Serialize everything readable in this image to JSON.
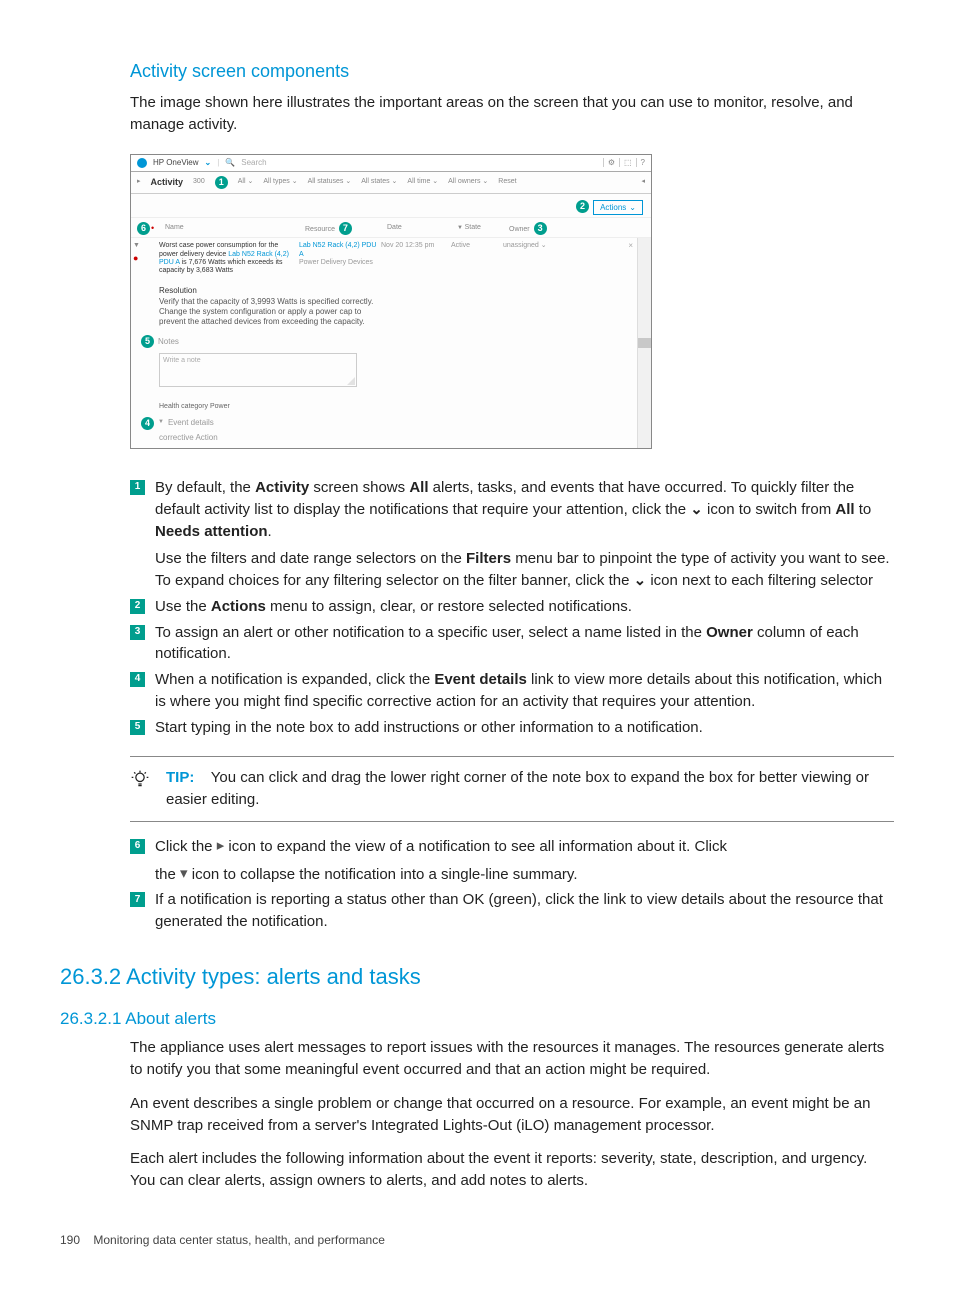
{
  "title": "Activity screen components",
  "intro": "The image shown here illustrates the important areas on the screen that you can use to monitor, resolve, and manage activity.",
  "figure": {
    "app_name": "HP OneView",
    "search_placeholder": "Search",
    "topbar_icons": [
      "⚙",
      "⬚",
      "?"
    ],
    "activity_label": "Activity",
    "activity_count": "300",
    "filters": [
      "All ⌄",
      "All types ⌄",
      "All statuses ⌄",
      "All states ⌄",
      "All time ⌄",
      "All owners ⌄",
      "Reset"
    ],
    "actions_label": "Actions",
    "columns": {
      "name": "Name",
      "resource": "Resource",
      "date": "Date",
      "state": "State",
      "owner": "Owner"
    },
    "row": {
      "desc_pre": "Worst case power consumption for the power delivery device ",
      "desc_link": "Lab N52 Rack (4,2) PDU A",
      "desc_post": " is 7,676 Watts which exceeds its capacity by 3,683 Watts",
      "resource_link": "Lab N52 Rack (4,2) PDU A",
      "resource_sub": "Power Delivery Devices",
      "date": "Nov 20 12:35 pm",
      "state": "Active",
      "owner": "unassigned ⌄"
    },
    "resolution_h": "Resolution",
    "resolution_text": "Verify that the capacity of 3,9993 Watts is specified correctly. Change the system configuration or apply a power cap to prevent the attached devices from exceeding the capacity.",
    "notes_h": "Notes",
    "note_placeholder": "Write a note",
    "health_line": "Health category Power",
    "event_details": "Event details",
    "corrective": "corrective Action"
  },
  "legend": {
    "i1a_pre": "By default, the ",
    "i1a_b1": "Activity",
    "i1a_mid1": " screen shows ",
    "i1a_b2": "All",
    "i1a_mid2": " alerts, tasks, and events that have occurred. To quickly filter the default activity list to display the notifications that require your attention, click the ",
    "i1a_post": " icon to switch from ",
    "i1a_b3": "All",
    "i1a_to": " to ",
    "i1a_b4": "Needs attention",
    "i1a_end": ".",
    "i1b_pre": "Use the filters and date range selectors on the ",
    "i1b_b1": "Filters",
    "i1b_mid": " menu bar to pinpoint the type of activity you want to see. To expand choices for any filtering selector on the filter banner, click the ",
    "i1b_post": " icon next to each filtering selector",
    "i2_pre": "Use the ",
    "i2_b": "Actions",
    "i2_post": " menu to assign, clear, or restore selected notifications.",
    "i3_pre": "To assign an alert or other notification to a specific user, select a name listed in the ",
    "i3_b": "Owner",
    "i3_post": " column of each notification.",
    "i4_pre": "When a notification is expanded, click the ",
    "i4_b": "Event details",
    "i4_post": " link to view more details about this notification, which is where you might find specific corrective action for an activity that requires your attention.",
    "i5": "Start typing in the note box to add instructions or other information to a notification."
  },
  "tip": {
    "label": "TIP:",
    "text": "You can click and drag the lower right corner of the note box to expand the box for better viewing or easier editing."
  },
  "cont": {
    "i6a": "Click the ",
    "i6b": " icon to expand the view of a notification to see all information about it. Click",
    "i6c": "the ",
    "i6d": " icon to collapse the notification into a single-line summary.",
    "i7": "If a notification is reporting a status other than OK (green), click the link to view details about the resource that generated the notification."
  },
  "h2": "26.3.2 Activity types: alerts and tasks",
  "h3": "26.3.2.1 About alerts",
  "p1": "The appliance uses alert messages to report issues with the resources it manages. The resources generate alerts to notify you that some meaningful event occurred and that an action might be required.",
  "p2": "An event describes a single problem or change that occurred on a resource. For example, an event might be an SNMP trap received from a server's Integrated Lights-Out (iLO) management processor.",
  "p3": "Each alert includes the following information about the event it reports: severity, state, description, and urgency. You can clear alerts, assign owners to alerts, and add notes to alerts.",
  "footer": {
    "page": "190",
    "title": "Monitoring data center status, health, and performance"
  }
}
